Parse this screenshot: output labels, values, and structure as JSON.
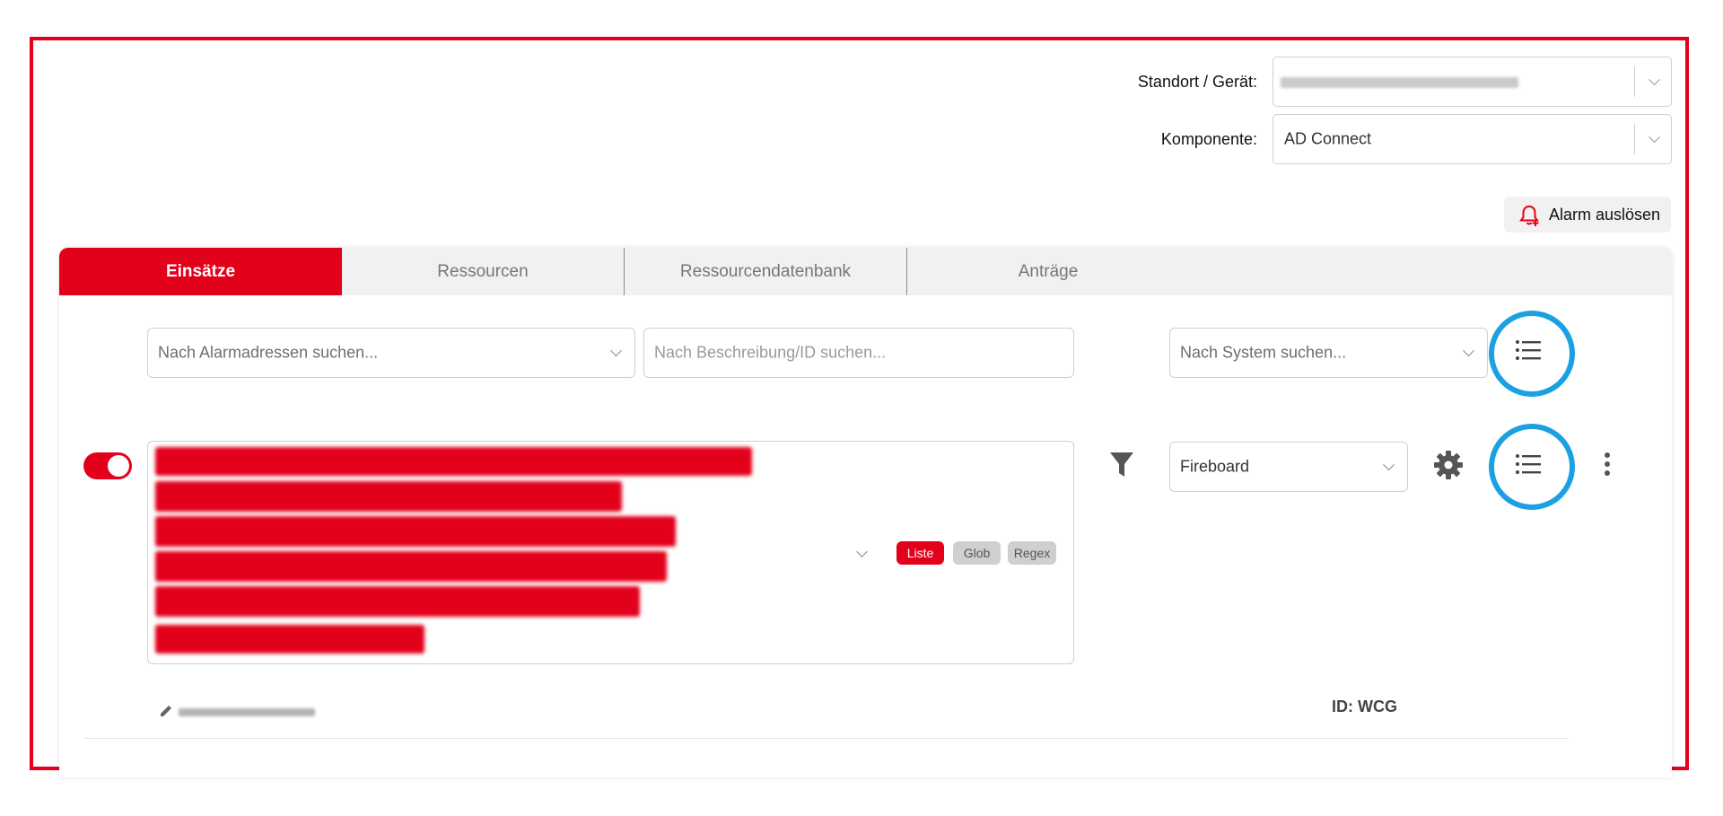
{
  "header": {
    "location_label": "Standort / Gerät:",
    "component_label": "Komponente:",
    "component_value": "AD Connect",
    "alarm_button_label": "Alarm auslösen"
  },
  "tabs": [
    {
      "label": "Einsätze",
      "active": true
    },
    {
      "label": "Ressourcen",
      "active": false
    },
    {
      "label": "Ressourcendatenbank",
      "active": false
    },
    {
      "label": "Anträge",
      "active": false
    }
  ],
  "filters": {
    "alarm_address_placeholder": "Nach Alarmadressen suchen...",
    "description_placeholder": "Nach Beschreibung/ID suchen...",
    "system_placeholder": "Nach System suchen..."
  },
  "entry": {
    "enabled": true,
    "system_value": "Fireboard",
    "match_modes": [
      {
        "label": "Liste",
        "selected": true
      },
      {
        "label": "Glob",
        "selected": false
      },
      {
        "label": "Regex",
        "selected": false
      }
    ],
    "id_text": "ID: WCG"
  },
  "colors": {
    "accent": "#e3001b",
    "highlight": "#1ba1e2",
    "tab_bg": "#f1f1f1"
  },
  "icons": [
    "bell-plus-icon",
    "list-icon",
    "filter-icon",
    "gear-icon",
    "more-vertical-icon",
    "pencil-icon",
    "chevron-down-icon"
  ]
}
